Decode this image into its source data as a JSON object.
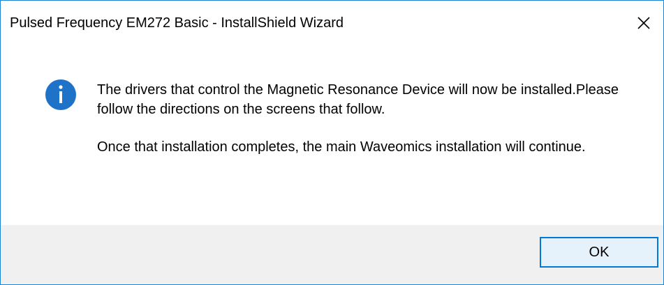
{
  "window": {
    "title": "Pulsed Frequency EM272 Basic - InstallShield Wizard",
    "close_icon": "close-icon"
  },
  "message": {
    "icon": "info-icon",
    "paragraph1": "The drivers that control the Magnetic Resonance Device will now be installed.Please follow the directions on the screens that follow.",
    "paragraph2": "Once that installation completes, the main Waveomics installation will continue."
  },
  "buttons": {
    "ok_label": "OK"
  },
  "colors": {
    "accent": "#0078d7",
    "info_icon": "#1e73c8",
    "footer_bg": "#f0f0f0",
    "window_border": "#1883d7"
  }
}
